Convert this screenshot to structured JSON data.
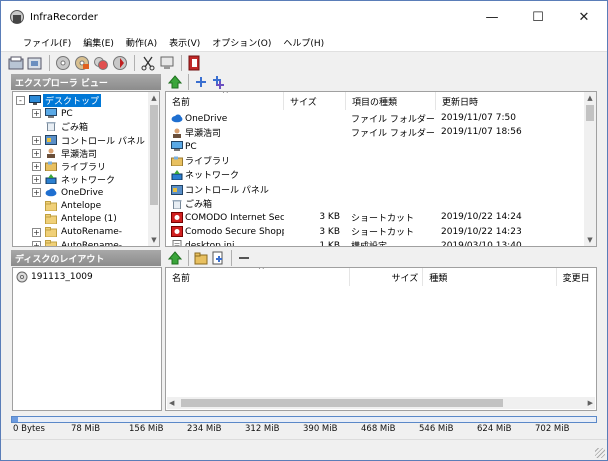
{
  "window": {
    "title": "InfraRecorder",
    "minimize_glyph": "—",
    "maximize_glyph": "☐",
    "close_glyph": "✕"
  },
  "menu": [
    "ファイル(F)",
    "編集(E)",
    "動作(A)",
    "表示(V)",
    "オプション(O)",
    "ヘルプ(H)"
  ],
  "toolbar": {
    "icons": [
      "new-project-icon",
      "open-project-icon",
      "burn-image-icon",
      "burn-compilation-icon",
      "copy-disc-icon",
      "disc-tool-icon",
      "cut-icon",
      "erase-icon",
      "exit-icon"
    ]
  },
  "explorer": {
    "header": "エクスプローラ ビュー",
    "sort_glyph": "^",
    "toolbar_icons": [
      "go-up-icon",
      "add-icon",
      "add-all-icon"
    ],
    "tree": [
      {
        "label": "デスクトップ",
        "level": 0,
        "expander": "-",
        "icon": "desktop",
        "selected": true
      },
      {
        "label": "PC",
        "level": 1,
        "expander": "+",
        "icon": "pc"
      },
      {
        "label": "ごみ箱",
        "level": 1,
        "expander": "",
        "icon": "trash"
      },
      {
        "label": "コントロール パネル",
        "level": 1,
        "expander": "+",
        "icon": "control"
      },
      {
        "label": "早瀬浩司",
        "level": 1,
        "expander": "+",
        "icon": "user"
      },
      {
        "label": "ライブラリ",
        "level": 1,
        "expander": "+",
        "icon": "library"
      },
      {
        "label": "ネットワーク",
        "level": 1,
        "expander": "+",
        "icon": "network"
      },
      {
        "label": "OneDrive",
        "level": 1,
        "expander": "+",
        "icon": "cloud"
      },
      {
        "label": "Antelope",
        "level": 1,
        "expander": "",
        "icon": "folder"
      },
      {
        "label": "Antelope (1)",
        "level": 1,
        "expander": "",
        "icon": "folder"
      },
      {
        "label": "AutoRename-",
        "level": 1,
        "expander": "+",
        "icon": "folder"
      },
      {
        "label": "AutoRename-",
        "level": 1,
        "expander": "+",
        "icon": "folder"
      }
    ],
    "columns": [
      "名前",
      "サイズ",
      "項目の種類",
      "更新日時"
    ],
    "files": [
      {
        "name": "OneDrive",
        "size": "",
        "type": "ファイル フォルダー",
        "date": "2019/11/07 7:50",
        "icon": "cloud"
      },
      {
        "name": "早瀬浩司",
        "size": "",
        "type": "ファイル フォルダー",
        "date": "2019/11/07 18:56",
        "icon": "user"
      },
      {
        "name": "PC",
        "size": "",
        "type": "",
        "date": "",
        "icon": "pc"
      },
      {
        "name": "ライブラリ",
        "size": "",
        "type": "",
        "date": "",
        "icon": "library"
      },
      {
        "name": "ネットワーク",
        "size": "",
        "type": "",
        "date": "",
        "icon": "network"
      },
      {
        "name": "コントロール パネル",
        "size": "",
        "type": "",
        "date": "",
        "icon": "control"
      },
      {
        "name": "ごみ箱",
        "size": "",
        "type": "",
        "date": "",
        "icon": "trash"
      },
      {
        "name": "COMODO Internet Sec...",
        "size": "3 KB",
        "type": "ショートカット",
        "date": "2019/10/22 14:24",
        "icon": "comodo"
      },
      {
        "name": "Comodo Secure Shopp...",
        "size": "3 KB",
        "type": "ショートカット",
        "date": "2019/10/22 14:23",
        "icon": "comodo"
      },
      {
        "name": "desktop.ini",
        "size": "1 KB",
        "type": "構成設定",
        "date": "2019/03/10 13:40",
        "icon": "ini"
      }
    ]
  },
  "disc": {
    "header": "ディスクのレイアウト",
    "sort_glyph": "^",
    "toolbar_icons": [
      "go-up-icon",
      "new-folder-icon",
      "add-files-icon",
      "remove-icon"
    ],
    "tree_item": "191113_1009",
    "columns": [
      "名前",
      "サイズ",
      "種類",
      "変更日"
    ]
  },
  "capacity": {
    "used_fraction": 0.01,
    "ticks": [
      "0 Bytes",
      "78 MiB",
      "156 MiB",
      "234 MiB",
      "312 MiB",
      "390 MiB",
      "468 MiB",
      "546 MiB",
      "624 MiB",
      "702 MiB"
    ]
  },
  "colors": {
    "selection": "#0078d7",
    "panel_header": "#9a9a9a",
    "capacity_bar": "#6c9be0"
  }
}
